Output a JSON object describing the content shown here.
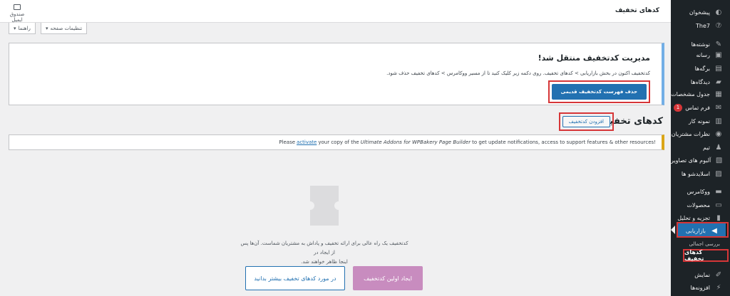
{
  "header": {
    "title": "کدهای تخفیف",
    "inbox_label": "صندوق ایمیل"
  },
  "screen_meta": {
    "screen_options": "تنظیمات صفحه",
    "help": "راهنما"
  },
  "notice": {
    "title": "مدیریت کدتخفیف منتقل شد!",
    "text": "کدتخفیف اکنون در بخش بازاریابی > کدهای تخفیف. روی دکمه زیر کلیک کنید تا از مسیر ووکامرس > کدهای تخفیف حذف شود.",
    "button": "حذف فهرست کدتخفیف قدیمی"
  },
  "page": {
    "heading": "کدهای تخفیف",
    "add_button": "افزودن کدتخفیف"
  },
  "plugin_notice": {
    "prefix": "Please",
    "link": "activate",
    "middle": "your copy of the",
    "product": "Ultimate Addons for WPBakery Page Builder",
    "suffix": "to get update notifications, access to support features & other resources!"
  },
  "empty_state": {
    "line1": "کدتخفیف یک راه عالی برای ارائه تخفیف و پاداش به مشتریان شماست. آن‌ها پس از ایجاد در",
    "line2": "اینجا ظاهر خواهند شد.",
    "primary_button": "ایجاد اولین کدتخفیف",
    "secondary_button": "در مورد کدهای تخفیف بیشتر بدانید"
  },
  "sidebar": {
    "items": [
      {
        "label": "پیشخوان",
        "icon": "dashboard-icon",
        "glyph": "◐"
      },
      {
        "label": "The7",
        "icon": "the7-icon",
        "glyph": "⑦"
      },
      {
        "label": "نوشته‌ها",
        "icon": "pin-icon",
        "glyph": "✎"
      },
      {
        "label": "رسانه",
        "icon": "media-icon",
        "glyph": "▣"
      },
      {
        "label": "برگه‌ها",
        "icon": "pages-icon",
        "glyph": "▤"
      },
      {
        "label": "دیدگاه‌ها",
        "icon": "comments-icon",
        "glyph": "▰"
      },
      {
        "label": "جدول مشخصات",
        "icon": "table-icon",
        "glyph": "▦"
      },
      {
        "label": "فرم تماس",
        "icon": "mail-icon",
        "glyph": "✉",
        "badge": "1"
      },
      {
        "label": "نمونه کار",
        "icon": "portfolio-icon",
        "glyph": "▥"
      },
      {
        "label": "نظرات مشتریان",
        "icon": "testimonials-icon",
        "glyph": "◉"
      },
      {
        "label": "تیم",
        "icon": "team-icon",
        "glyph": "♟"
      },
      {
        "label": "آلبوم های تصاویر",
        "icon": "gallery-icon",
        "glyph": "▧"
      },
      {
        "label": "اسلایدشو ها",
        "icon": "slideshow-icon",
        "glyph": "▨"
      },
      {
        "label": "ووکامرس",
        "icon": "woocommerce-icon",
        "glyph": "▬"
      },
      {
        "label": "محصولات",
        "icon": "products-icon",
        "glyph": "▭"
      },
      {
        "label": "تجزیه و تحلیل",
        "icon": "analytics-icon",
        "glyph": "▮"
      },
      {
        "label": "بازاریابی",
        "icon": "megaphone-icon",
        "glyph": "◀"
      },
      {
        "label": "نمایش",
        "icon": "appearance-icon",
        "glyph": "✐"
      },
      {
        "label": "افزونه‌ها",
        "icon": "plugins-icon",
        "glyph": "⚡"
      }
    ],
    "sub_overview": "بررسی اجمالی",
    "sub_current": "کدهای تخفیف"
  },
  "colors": {
    "primary": "#2271b1",
    "cta_primary": "#c88cbf",
    "highlight": "#d63638",
    "sidebar_bg": "#1d2327"
  }
}
